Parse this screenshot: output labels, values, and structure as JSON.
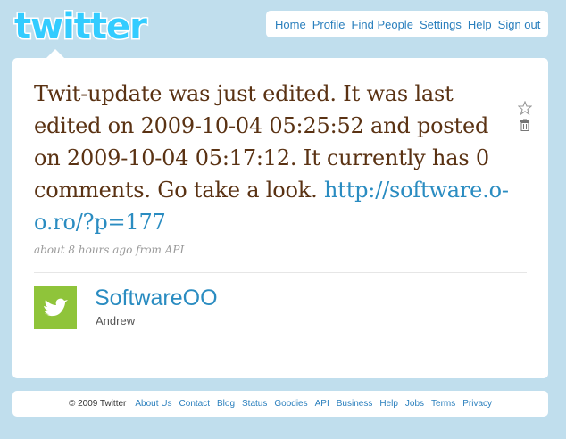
{
  "logo": {
    "text": "twitter"
  },
  "topnav": {
    "items": [
      "Home",
      "Profile",
      "Find People",
      "Settings",
      "Help",
      "Sign out"
    ]
  },
  "tweet": {
    "text": "Twit-update was just edited. It was last edited on 2009-10-04 05:25:52 and posted on 2009-10-04 05:17:12. It currently has 0 comments. Go take a look.",
    "link": "http://software.o-o.ro/?p=177",
    "meta_time": "about 8 hours ago",
    "meta_from": "from API"
  },
  "user": {
    "screen_name": "SoftwareOO",
    "real_name": "Andrew"
  },
  "footer": {
    "copyright": "© 2009 Twitter",
    "links": [
      "About Us",
      "Contact",
      "Blog",
      "Status",
      "Goodies",
      "API",
      "Business",
      "Help",
      "Jobs",
      "Terms",
      "Privacy"
    ]
  },
  "colors": {
    "background": "#c0deed",
    "tweet_text": "#5a3213",
    "link": "#2a8cc1",
    "nav_link": "#2a7fbd",
    "avatar": "#8fc43a"
  }
}
